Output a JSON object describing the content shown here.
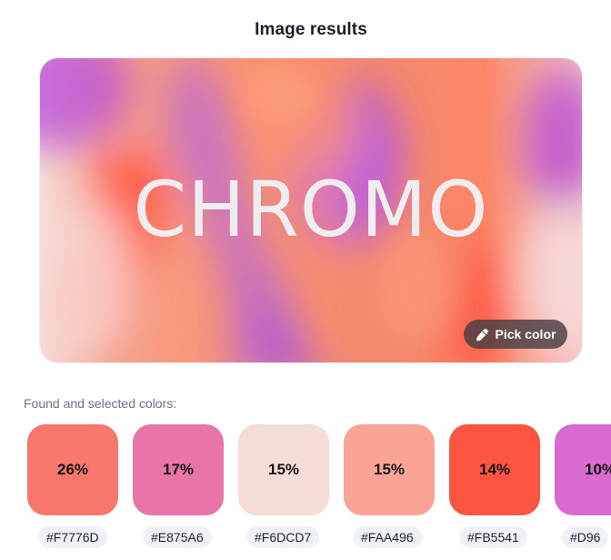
{
  "header": {
    "title": "Image results"
  },
  "image": {
    "overlay_text": "CHROMO"
  },
  "actions": {
    "pick_color_label": "Pick color",
    "pick_color_icon": "eyedropper-icon"
  },
  "colors_section": {
    "label": "Found and selected colors:",
    "colors": [
      {
        "percent": "26%",
        "hex": "#F7776D",
        "color": "#F7776D"
      },
      {
        "percent": "17%",
        "hex": "#E875A6",
        "color": "#E875A6"
      },
      {
        "percent": "15%",
        "hex": "#F6DCD7",
        "color": "#F6DCD7"
      },
      {
        "percent": "15%",
        "hex": "#FAA496",
        "color": "#FAA496"
      },
      {
        "percent": "14%",
        "hex": "#FB5541",
        "color": "#FB5541"
      },
      {
        "percent": "10%",
        "hex": "#D96",
        "color": "#D96AD1"
      }
    ]
  }
}
